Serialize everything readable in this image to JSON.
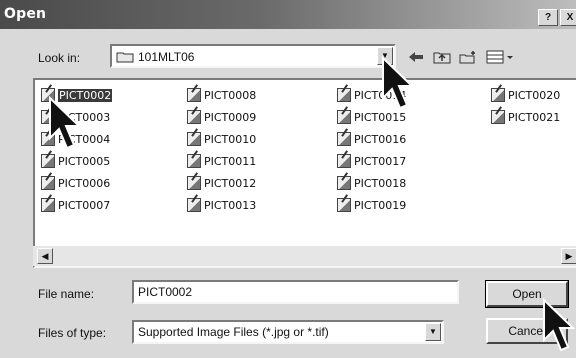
{
  "window": {
    "title": "Open",
    "help_label": "?",
    "close_label": "X"
  },
  "lookin": {
    "label": "Look in:",
    "folder": "101MLT06"
  },
  "toolbar": {
    "back_icon": "back-arrow-icon",
    "up_icon": "up-folder-icon",
    "new_folder_icon": "new-folder-icon",
    "view_icon": "view-menu-icon"
  },
  "files": [
    {
      "name": "PICT0002",
      "selected": true
    },
    {
      "name": "PICT0003"
    },
    {
      "name": "PICT0004"
    },
    {
      "name": "PICT0005"
    },
    {
      "name": "PICT0006"
    },
    {
      "name": "PICT0007"
    },
    {
      "name": "PICT0008"
    },
    {
      "name": "PICT0009"
    },
    {
      "name": "PICT0010"
    },
    {
      "name": "PICT0011"
    },
    {
      "name": "PICT0012"
    },
    {
      "name": "PICT0013"
    },
    {
      "name": "PICT0014"
    },
    {
      "name": "PICT0015"
    },
    {
      "name": "PICT0016"
    },
    {
      "name": "PICT0017"
    },
    {
      "name": "PICT0018"
    },
    {
      "name": "PICT0019"
    },
    {
      "name": "PICT0020"
    },
    {
      "name": "PICT0021"
    }
  ],
  "filename": {
    "label": "File name:",
    "value": "PICT0002"
  },
  "filetype": {
    "label": "Files of type:",
    "value": "Supported Image Files (*.jpg or *.tif)"
  },
  "buttons": {
    "open": "Open",
    "cancel": "Cancel"
  }
}
